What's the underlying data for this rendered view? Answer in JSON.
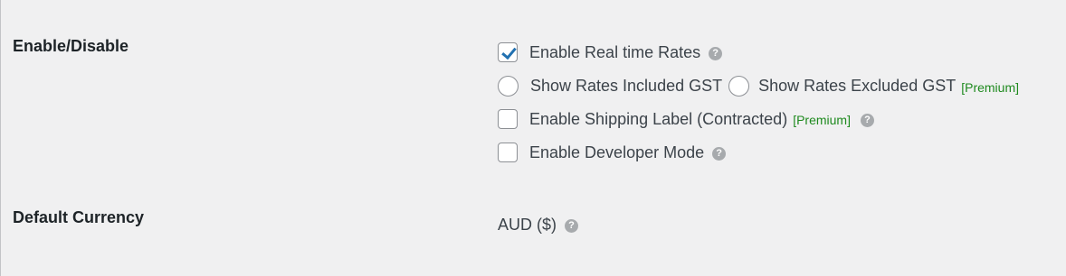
{
  "rows": {
    "enable": {
      "label": "Enable/Disable",
      "options": {
        "realtime": {
          "label": "Enable Real time Rates",
          "checked": true
        },
        "gst_included": {
          "label": "Show Rates Included GST"
        },
        "gst_excluded": {
          "label": "Show Rates Excluded GST",
          "badge": "[Premium]"
        },
        "shipping_label": {
          "label": "Enable Shipping Label (Contracted)",
          "badge": "[Premium]",
          "checked": false
        },
        "developer": {
          "label": "Enable Developer Mode",
          "checked": false
        }
      }
    },
    "currency": {
      "label": "Default Currency",
      "value": "AUD ($)"
    }
  },
  "help_glyph": "?",
  "colors": {
    "background": "#f0f0f1",
    "premium": "#1e8a1e",
    "check": "#2271b1",
    "help_icon": "#a7aaad"
  }
}
